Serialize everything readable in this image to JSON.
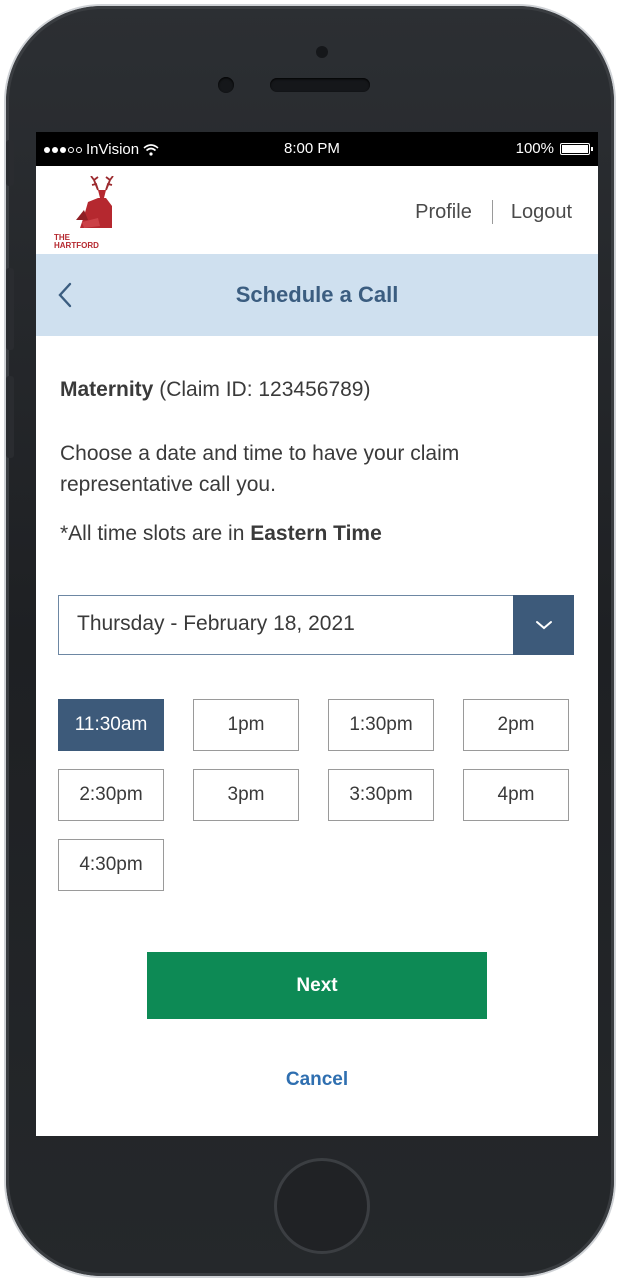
{
  "status_bar": {
    "carrier": "InVision",
    "time": "8:00 PM",
    "battery": "100%",
    "battery_level": 1.0
  },
  "header": {
    "logo_text_line1": "THE",
    "logo_text_line2": "HARTFORD",
    "profile_label": "Profile",
    "logout_label": "Logout"
  },
  "title_bar": {
    "title": "Schedule a Call",
    "back_icon": "chevron-left-icon"
  },
  "claim": {
    "type": "Maternity",
    "id_text": "(Claim ID: 123456789)"
  },
  "instructions": "Choose a date and time to have your claim representative call you.",
  "timezone_note": {
    "prefix": "*All time slots are in",
    "zone": "Eastern Time"
  },
  "date_select": {
    "value": "Thursday - February 18, 2021",
    "icon": "chevron-down-icon"
  },
  "time_slots": [
    {
      "label": "11:30am",
      "selected": true
    },
    {
      "label": "1pm",
      "selected": false
    },
    {
      "label": "1:30pm",
      "selected": false
    },
    {
      "label": "2pm",
      "selected": false
    },
    {
      "label": "2:30pm",
      "selected": false
    },
    {
      "label": "3pm",
      "selected": false
    },
    {
      "label": "3:30pm",
      "selected": false
    },
    {
      "label": "4pm",
      "selected": false
    },
    {
      "label": "4:30pm",
      "selected": false
    }
  ],
  "actions": {
    "next_label": "Next",
    "cancel_label": "Cancel"
  },
  "colors": {
    "brand_red": "#b5282f",
    "title_bar_bg": "#cfe0ef",
    "accent_navy": "#3d5a7a",
    "next_green": "#0d8a55",
    "link_blue": "#2f6fb0"
  }
}
